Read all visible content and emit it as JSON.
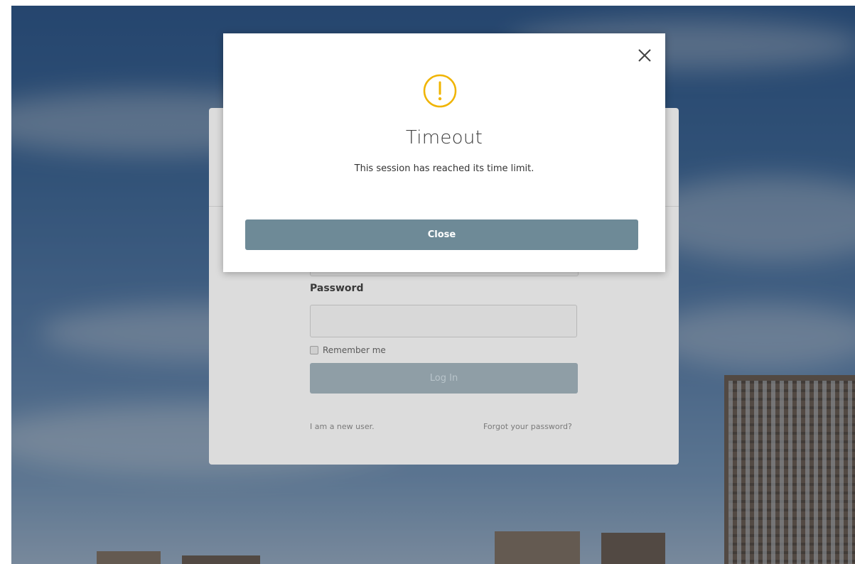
{
  "modal": {
    "title": "Timeout",
    "message": "This session has reached its time limit.",
    "close_button_label": "Close",
    "icon": "warning-icon",
    "accent_color": "#f0b400"
  },
  "login": {
    "password_label": "Password",
    "password_value": "",
    "remember_label": "Remember me",
    "login_button_label": "Log In",
    "new_user_link": "I am a new user.",
    "forgot_password_link": "Forgot your password?"
  }
}
